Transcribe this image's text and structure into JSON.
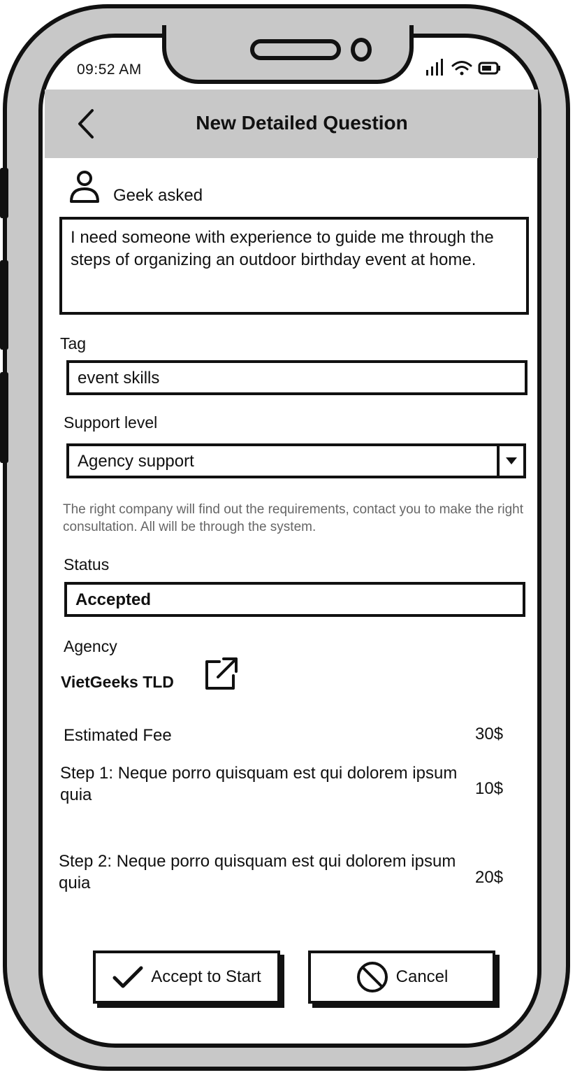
{
  "status_bar": {
    "time": "09:52 AM",
    "icons": [
      "signal-icon",
      "wifi-icon",
      "battery-icon"
    ]
  },
  "header": {
    "back_icon": "chevron-left-icon",
    "title": "New Detailed Question"
  },
  "asker": {
    "icon": "user-icon",
    "label": "Geek asked"
  },
  "question": {
    "text": "I need someone with experience to guide me through the steps of organizing an outdoor birthday event at home."
  },
  "tag": {
    "label": "Tag",
    "value": "event skills"
  },
  "support_level": {
    "label": "Support level",
    "value": "Agency support",
    "hint": "The right company will find out the requirements, contact you to make the right consultation. All will be through the system."
  },
  "status": {
    "label": "Status",
    "value": "Accepted"
  },
  "agency": {
    "label": "Agency",
    "name": "VietGeeks TLD",
    "link_icon": "external-link-icon"
  },
  "fees": {
    "estimated_label": "Estimated Fee",
    "estimated_value": "30$",
    "steps": [
      {
        "label": "Step 1: Neque porro quisquam est qui dolorem ipsum quia",
        "amount": "10$"
      },
      {
        "label": "Step 2: Neque porro quisquam est qui dolorem ipsum quia",
        "amount": "20$"
      }
    ]
  },
  "actions": {
    "accept_label": "Accept to Start",
    "accept_icon": "checkmark-icon",
    "cancel_label": "Cancel",
    "cancel_icon": "cancel-circle-icon"
  },
  "colors": {
    "shell": "#c8c8c8",
    "outline": "#111111",
    "hint_text": "#666666"
  }
}
